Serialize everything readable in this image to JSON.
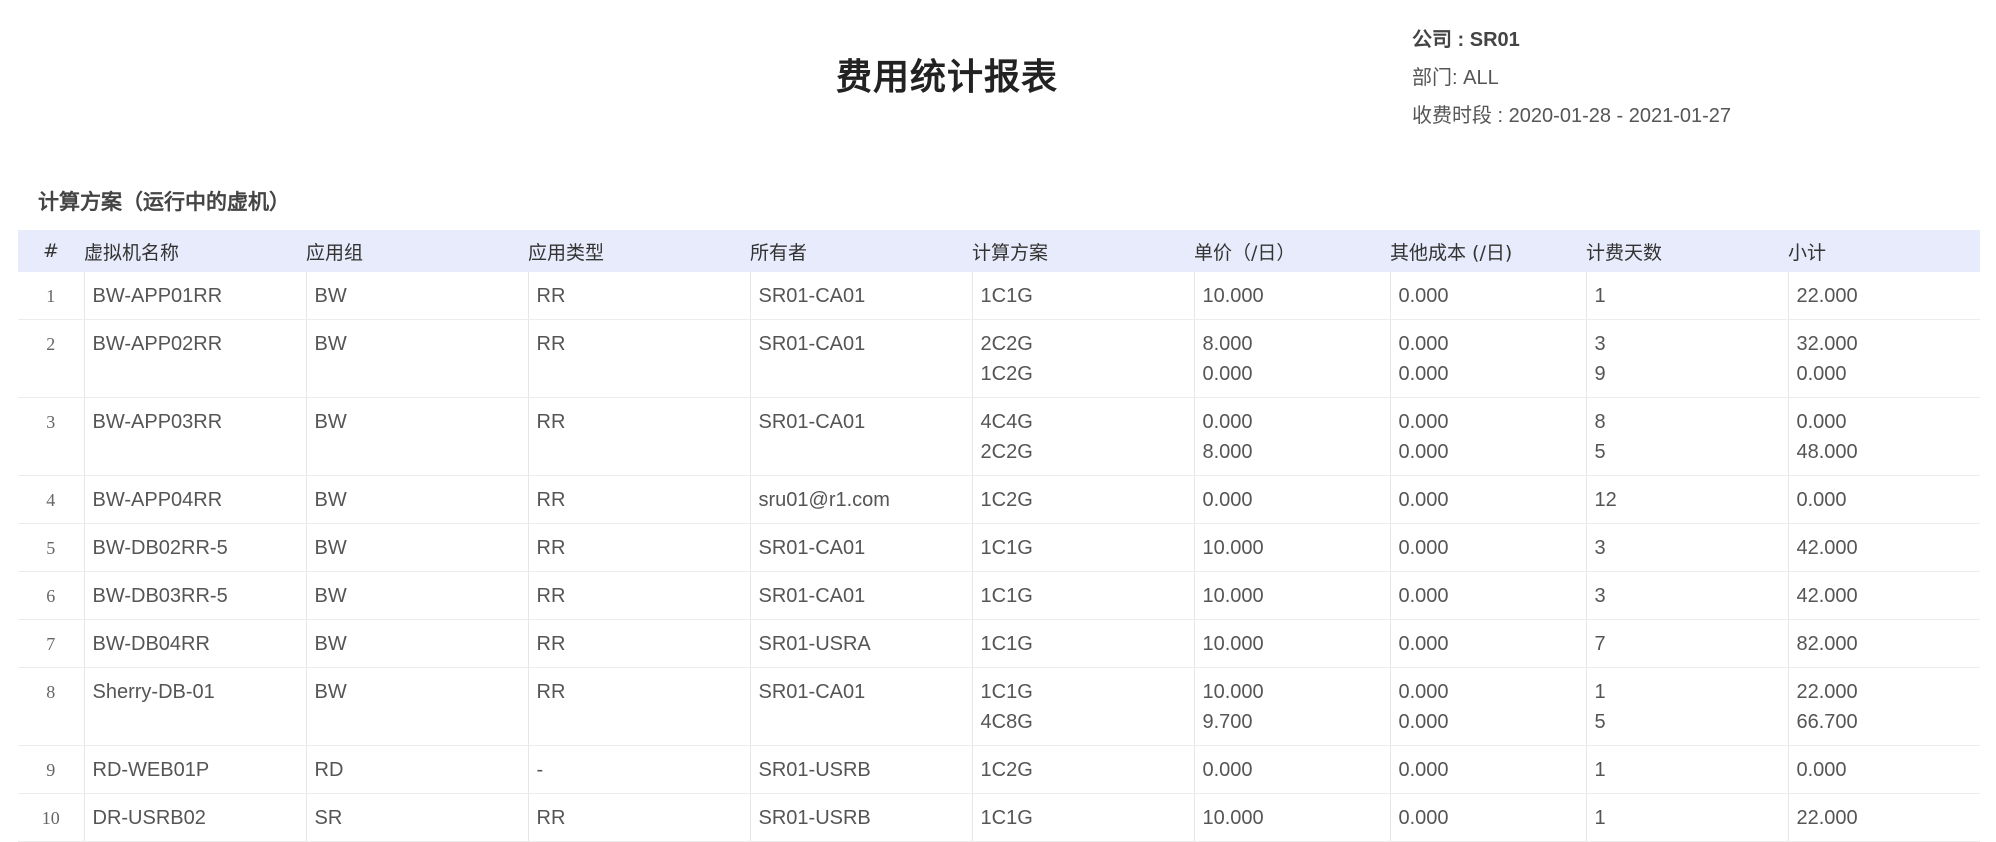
{
  "title": "费用统计报表",
  "meta": {
    "company": "公司 : SR01",
    "department": "部门: ALL",
    "period": "收费时段 : 2020-01-28 - 2021-01-27"
  },
  "section_title": "计算方案（运行中的虚机）",
  "columns": [
    "#",
    "虚拟机名称",
    "应用组",
    "应用类型",
    "所有者",
    "计算方案",
    "单价（/日）",
    "其他成本 (/日)",
    "计费天数",
    "小计"
  ],
  "rows": [
    {
      "idx": "1",
      "vm": "BW-APP01RR",
      "group": "BW",
      "type": "RR",
      "owner": "SR01-CA01",
      "plans": [
        "1C1G"
      ],
      "prices": [
        "10.000"
      ],
      "other": [
        "0.000"
      ],
      "days": [
        "1"
      ],
      "subtotal": [
        "22.000"
      ]
    },
    {
      "idx": "2",
      "vm": "BW-APP02RR",
      "group": "BW",
      "type": "RR",
      "owner": "SR01-CA01",
      "plans": [
        "2C2G",
        "1C2G"
      ],
      "prices": [
        "8.000",
        "0.000"
      ],
      "other": [
        "0.000",
        "0.000"
      ],
      "days": [
        "3",
        "9"
      ],
      "subtotal": [
        "32.000",
        "0.000"
      ]
    },
    {
      "idx": "3",
      "vm": "BW-APP03RR",
      "group": "BW",
      "type": "RR",
      "owner": "SR01-CA01",
      "plans": [
        "4C4G",
        "2C2G"
      ],
      "prices": [
        "0.000",
        "8.000"
      ],
      "other": [
        "0.000",
        "0.000"
      ],
      "days": [
        "8",
        "5"
      ],
      "subtotal": [
        "0.000",
        "48.000"
      ]
    },
    {
      "idx": "4",
      "vm": "BW-APP04RR",
      "group": "BW",
      "type": "RR",
      "owner": "sru01@r1.com",
      "plans": [
        "1C2G"
      ],
      "prices": [
        "0.000"
      ],
      "other": [
        "0.000"
      ],
      "days": [
        "12"
      ],
      "subtotal": [
        "0.000"
      ]
    },
    {
      "idx": "5",
      "vm": "BW-DB02RR-5",
      "group": "BW",
      "type": "RR",
      "owner": "SR01-CA01",
      "plans": [
        "1C1G"
      ],
      "prices": [
        "10.000"
      ],
      "other": [
        "0.000"
      ],
      "days": [
        "3"
      ],
      "subtotal": [
        "42.000"
      ]
    },
    {
      "idx": "6",
      "vm": "BW-DB03RR-5",
      "group": "BW",
      "type": "RR",
      "owner": "SR01-CA01",
      "plans": [
        "1C1G"
      ],
      "prices": [
        "10.000"
      ],
      "other": [
        "0.000"
      ],
      "days": [
        "3"
      ],
      "subtotal": [
        "42.000"
      ]
    },
    {
      "idx": "7",
      "vm": "BW-DB04RR",
      "group": "BW",
      "type": "RR",
      "owner": "SR01-USRA",
      "plans": [
        "1C1G"
      ],
      "prices": [
        "10.000"
      ],
      "other": [
        "0.000"
      ],
      "days": [
        "7"
      ],
      "subtotal": [
        "82.000"
      ]
    },
    {
      "idx": "8",
      "vm": "Sherry-DB-01",
      "group": "BW",
      "type": "RR",
      "owner": "SR01-CA01",
      "plans": [
        "1C1G",
        "4C8G"
      ],
      "prices": [
        "10.000",
        "9.700"
      ],
      "other": [
        "0.000",
        "0.000"
      ],
      "days": [
        "1",
        "5"
      ],
      "subtotal": [
        "22.000",
        "66.700"
      ]
    },
    {
      "idx": "9",
      "vm": "RD-WEB01P",
      "group": "RD",
      "type": "-",
      "owner": "SR01-USRB",
      "plans": [
        "1C2G"
      ],
      "prices": [
        "0.000"
      ],
      "other": [
        "0.000"
      ],
      "days": [
        "1"
      ],
      "subtotal": [
        "0.000"
      ]
    },
    {
      "idx": "10",
      "vm": "DR-USRB02",
      "group": "SR",
      "type": "RR",
      "owner": "SR01-USRB",
      "plans": [
        "1C1G"
      ],
      "prices": [
        "10.000"
      ],
      "other": [
        "0.000"
      ],
      "days": [
        "1"
      ],
      "subtotal": [
        "22.000"
      ]
    }
  ]
}
